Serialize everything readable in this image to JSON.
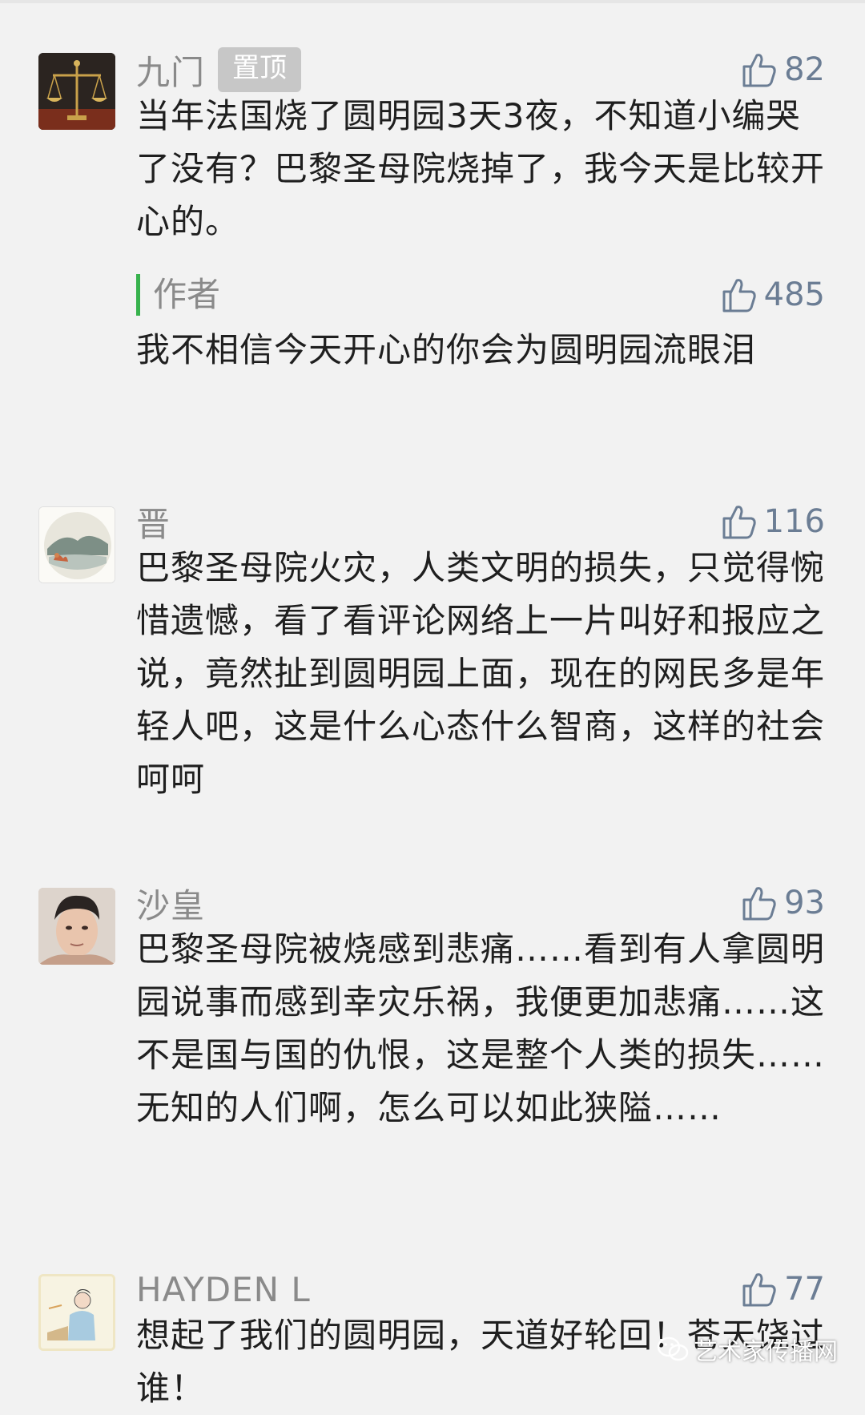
{
  "comments": [
    {
      "nickname": "九门",
      "badge": "置顶",
      "likes": "82",
      "text": "当年法国烧了圆明园3天3夜，不知道小编哭了没有？巴黎圣母院烧掉了，我今天是比较开心的。",
      "avatar_icon": "scales-of-justice",
      "reply": {
        "label": "作者",
        "likes": "485",
        "text": "我不相信今天开心的你会为圆明园流眼泪"
      }
    },
    {
      "nickname": "晋",
      "likes": "116",
      "text": "巴黎圣母院火灾，人类文明的损失，只觉得惋惜遗憾，看了看评论网络上一片叫好和报应之说，竟然扯到圆明园上面，现在的网民多是年轻人吧，这是什么心态什么智商，这样的社会 呵呵",
      "avatar_icon": "landscape-painting"
    },
    {
      "nickname": "沙皇",
      "likes": "93",
      "text": "巴黎圣母院被烧感到悲痛……看到有人拿圆明园说事而感到幸灾乐祸，我便更加悲痛……这不是国与国的仇恨，这是整个人类的损失……无知的人们啊，怎么可以如此狭隘……",
      "avatar_icon": "man-portrait"
    },
    {
      "nickname": "HAYDEN L",
      "likes": "77",
      "text": "想起了我们的圆明园，天道好轮回！苍天饶过谁！",
      "avatar_icon": "drawing-portrait"
    }
  ],
  "watermark": "艺术家传播网",
  "colors": {
    "background": "#f2f2f2",
    "nickname": "#8a8a8a",
    "like": "#6b7d94",
    "author_bar": "#37b24d",
    "badge": "#c7c7c7"
  }
}
